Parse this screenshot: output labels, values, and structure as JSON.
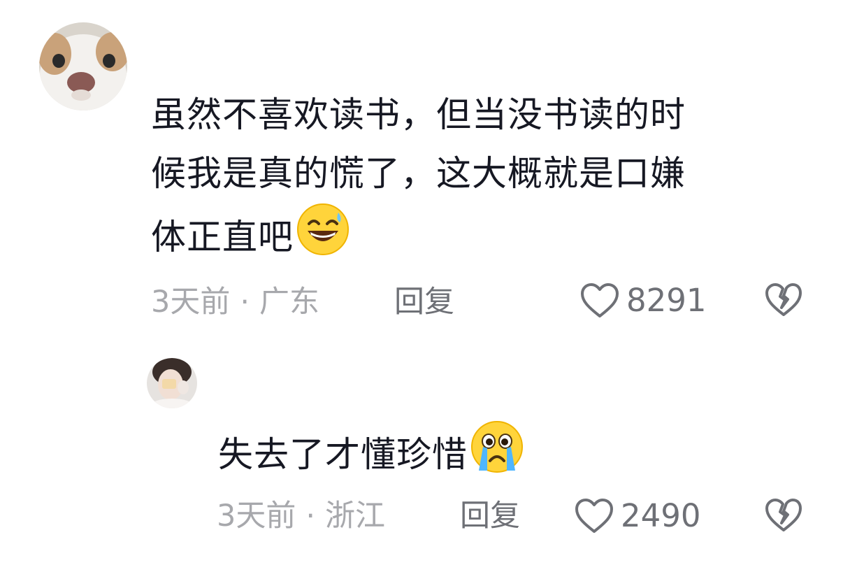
{
  "comments": [
    {
      "avatar_icon": "cat-avatar-icon",
      "lines": [
        "虽然不喜欢读书，但当没书读的时",
        "候我是真的慌了，这大概就是口嫌",
        "体正直吧"
      ],
      "emoji": "grinning-sweat-emoji",
      "time": "3天前",
      "separator": "·",
      "location": "广东",
      "reply_label": "回复",
      "like_count": "8291"
    },
    {
      "avatar_icon": "girl-avatar-icon",
      "text": "失去了才懂珍惜",
      "emoji": "crying-emoji",
      "time": "3天前",
      "separator": "·",
      "location": "浙江",
      "reply_label": "回复",
      "like_count": "2490"
    }
  ],
  "colors": {
    "text": "#161823",
    "meta": "#a7a8ac",
    "action": "#6e7076"
  }
}
